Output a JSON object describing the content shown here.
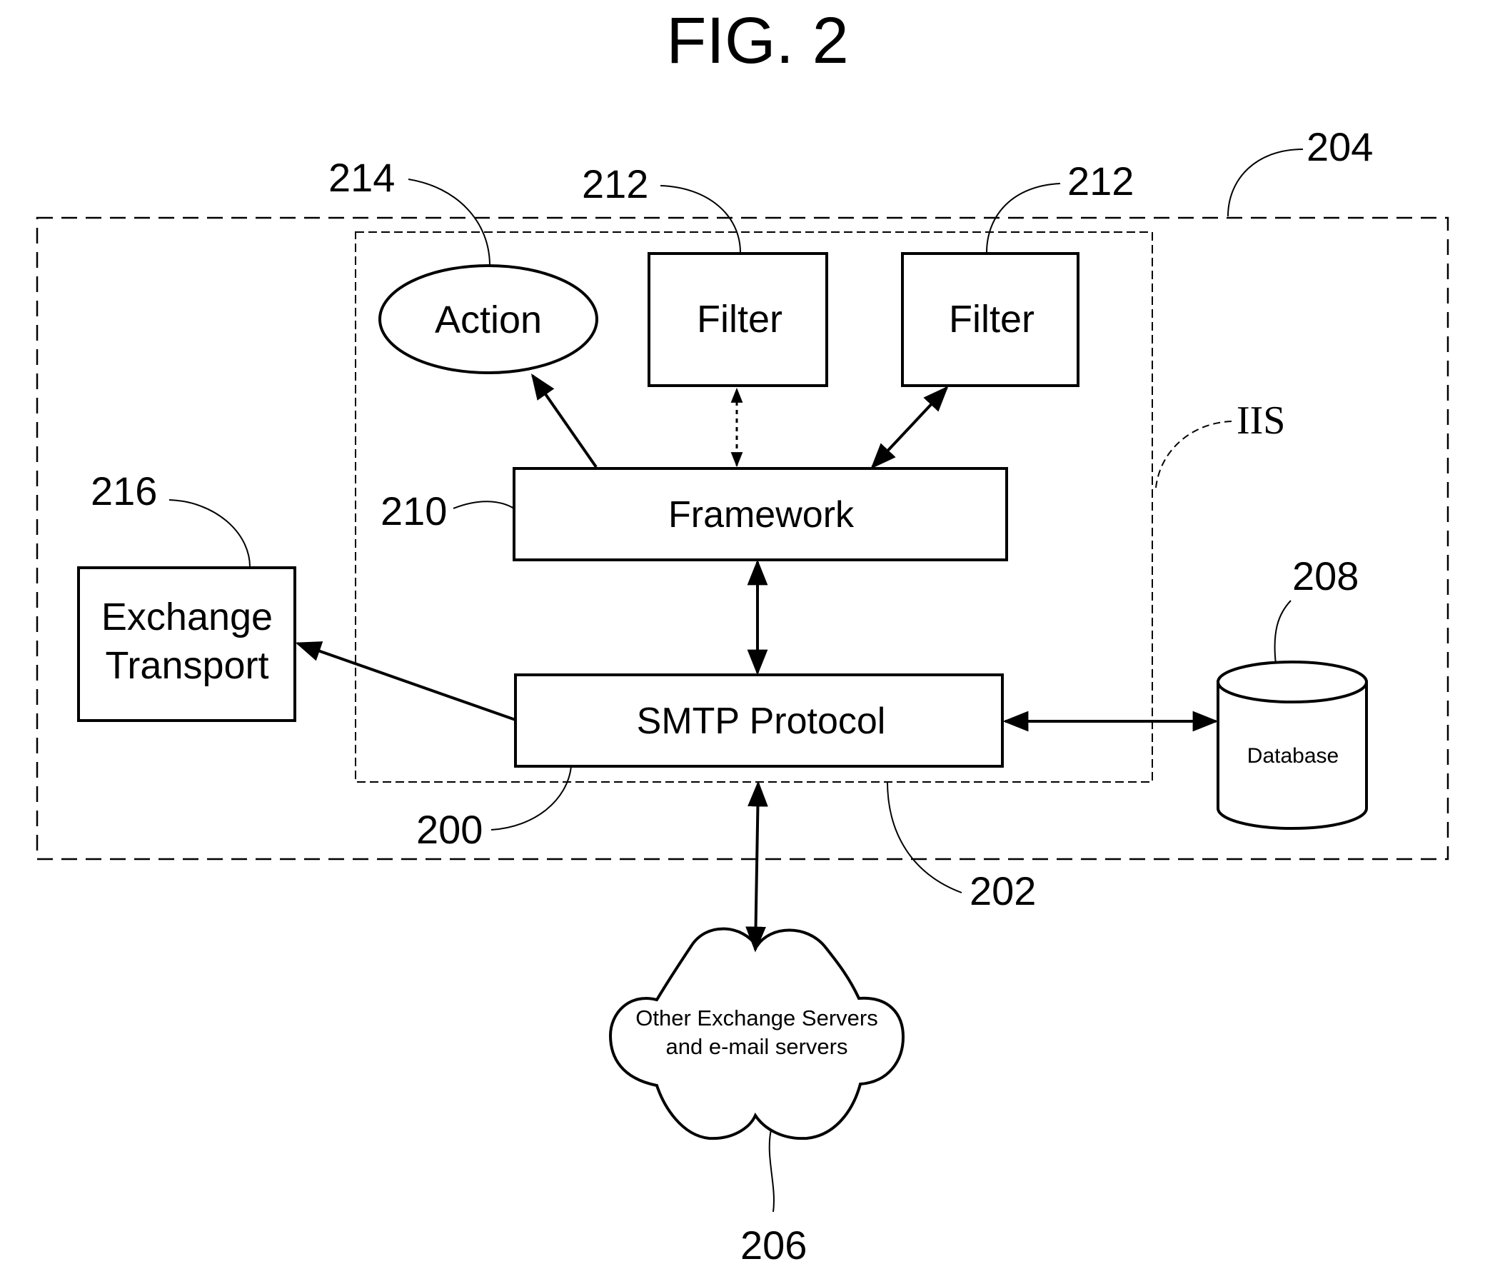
{
  "figure": {
    "title": "FIG. 2",
    "type": "block-diagram"
  },
  "containers": {
    "outer_system": {
      "ref": "204"
    },
    "iis_host": {
      "ref": "202",
      "label": "IIS"
    }
  },
  "nodes": {
    "action": {
      "label": "Action",
      "ref": "214",
      "shape": "ellipse"
    },
    "filter_1": {
      "label": "Filter",
      "ref": "212",
      "shape": "rectangle"
    },
    "filter_2": {
      "label": "Filter",
      "ref": "212",
      "shape": "rectangle"
    },
    "framework": {
      "label": "Framework",
      "ref": "210",
      "shape": "rectangle"
    },
    "smtp": {
      "label": "SMTP Protocol",
      "ref": "200",
      "shape": "rectangle"
    },
    "exchange_transport": {
      "label_line1": "Exchange",
      "label_line2": "Transport",
      "ref": "216",
      "shape": "rectangle"
    },
    "database": {
      "label": "Database",
      "ref": "208",
      "shape": "cylinder"
    },
    "cloud": {
      "label_line1": "Other Exchange Servers",
      "label_line2": "and e-mail servers",
      "ref": "206",
      "shape": "cloud"
    }
  },
  "connections": [
    {
      "from": "framework",
      "to": "action",
      "direction": "one-way",
      "style": "solid"
    },
    {
      "from": "framework",
      "to": "filter_1",
      "direction": "bidirectional",
      "style": "dotted"
    },
    {
      "from": "framework",
      "to": "filter_2",
      "direction": "bidirectional",
      "style": "solid"
    },
    {
      "from": "framework",
      "to": "smtp",
      "direction": "bidirectional",
      "style": "solid"
    },
    {
      "from": "smtp",
      "to": "exchange_transport",
      "direction": "one-way",
      "style": "solid"
    },
    {
      "from": "smtp",
      "to": "database",
      "direction": "bidirectional",
      "style": "solid"
    },
    {
      "from": "smtp",
      "to": "cloud",
      "direction": "bidirectional",
      "style": "solid"
    }
  ]
}
